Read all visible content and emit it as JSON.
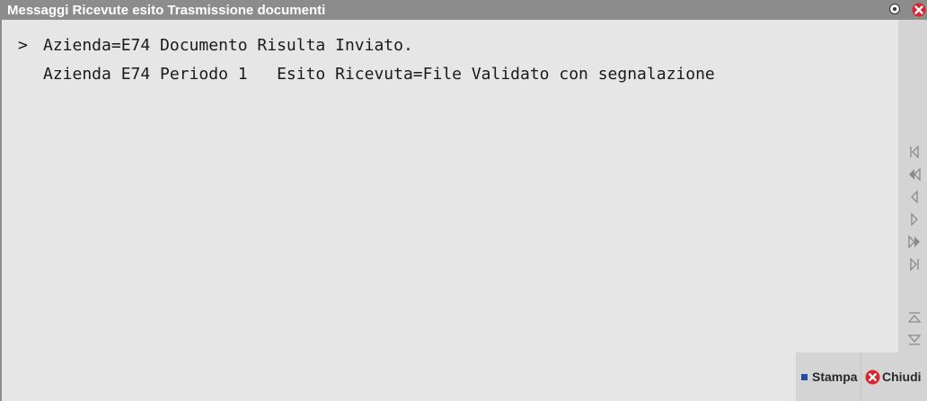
{
  "window": {
    "title": "Messaggi Ricevute esito Trasmissione documenti",
    "colors": {
      "titlebar": "#8c8c8c",
      "background": "#e6e6e6",
      "close_red": "#d9252b",
      "nav_strip": "#d4d4d4"
    }
  },
  "messages": {
    "prompt": ">",
    "line1": "Azienda=E74 Documento Risulta Inviato.",
    "line2": "Azienda E74 Periodo 1   Esito Ricevuta=File Validato con segnalazione"
  },
  "navigation": {
    "icons": [
      "first-icon",
      "fast-back-icon",
      "prev-icon",
      "next-icon",
      "fast-forward-icon",
      "last-icon",
      "scroll-top-icon",
      "scroll-bottom-icon"
    ]
  },
  "actions": {
    "stampa_label": "Stampa",
    "chiudi_label": "Chiudi"
  }
}
